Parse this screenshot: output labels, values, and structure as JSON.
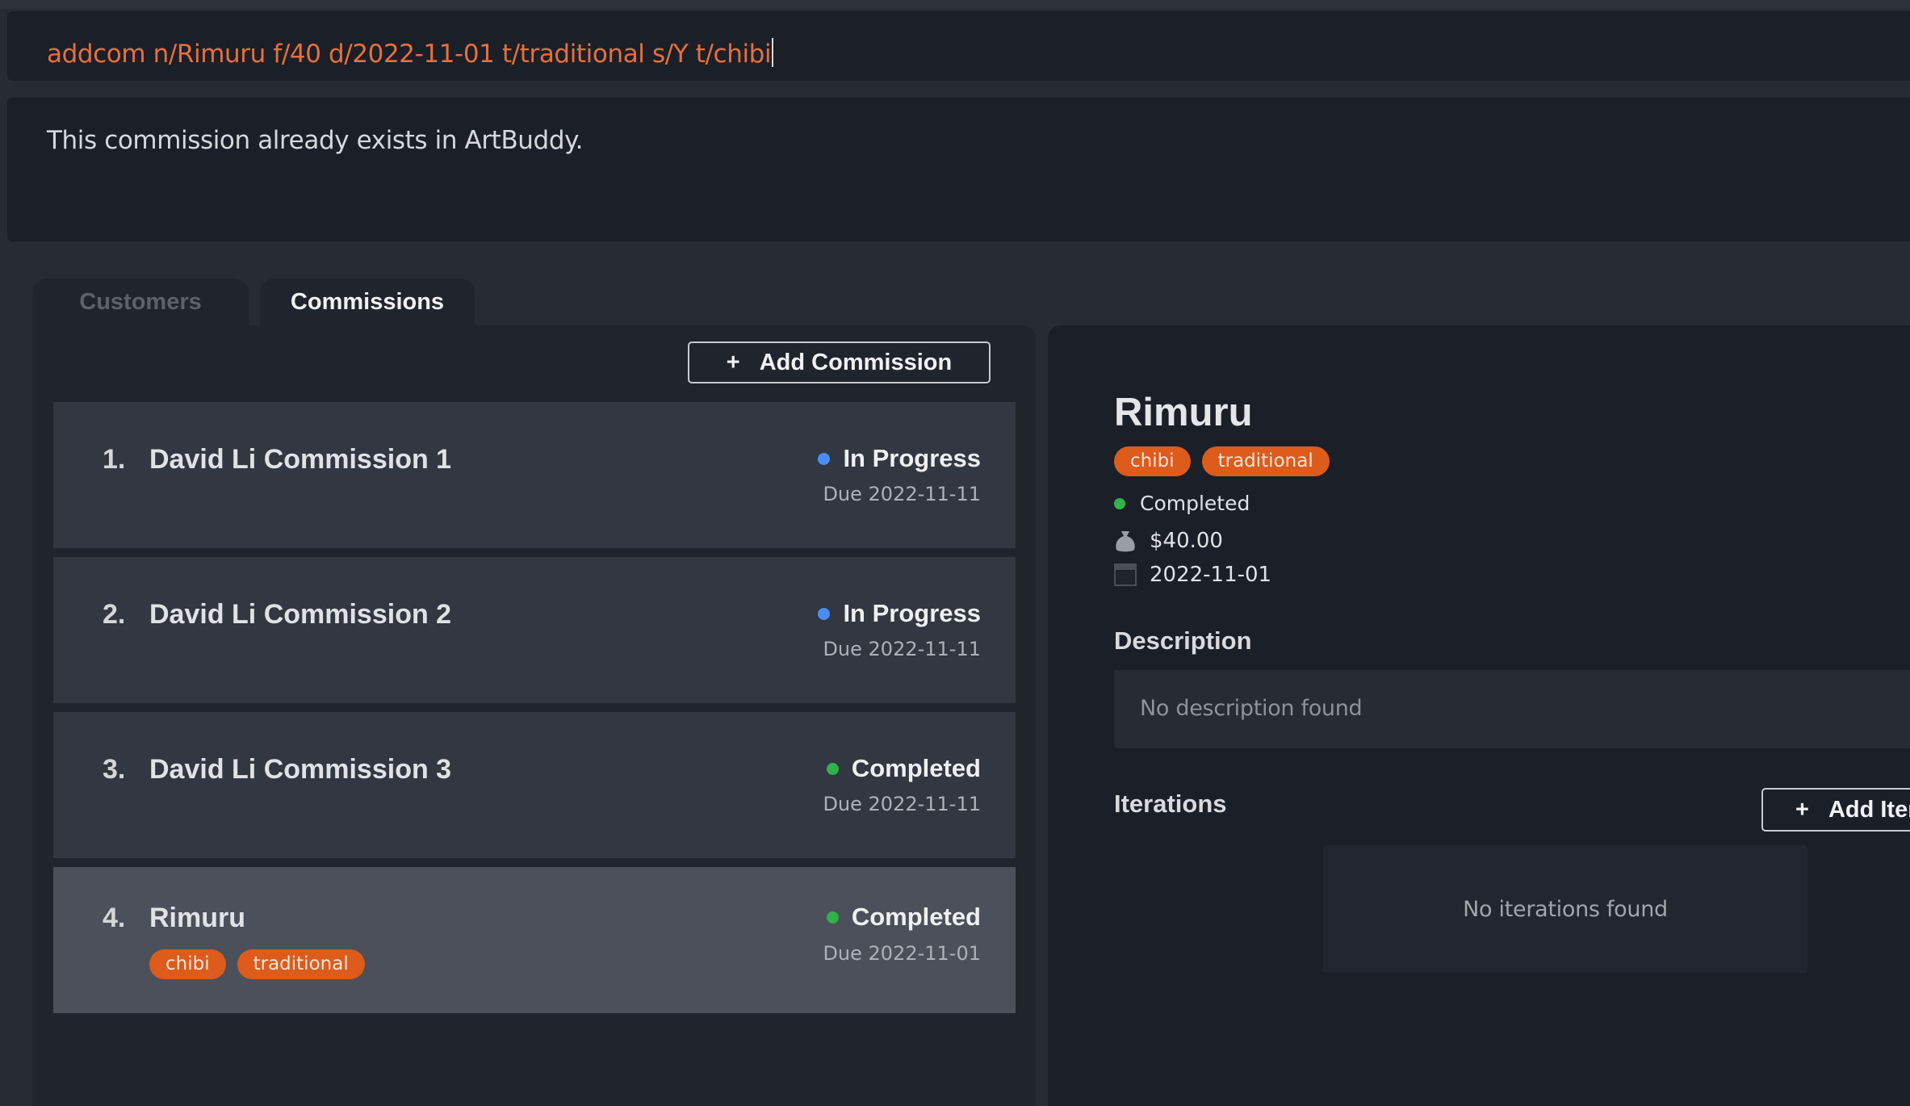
{
  "command": {
    "value": "addcom n/Rimuru f/40 d/2022-11-01 t/traditional s/Y t/chibi"
  },
  "result": {
    "message": "This commission already exists in ArtBuddy."
  },
  "tabs": [
    {
      "label": "Customers",
      "active": false
    },
    {
      "label": "Commissions",
      "active": true
    }
  ],
  "commission_list": {
    "add_button_label": "Add Commission",
    "add_button_icon": "+",
    "items": [
      {
        "index": "1.",
        "title": "David Li Commission 1",
        "status": "In Progress",
        "status_color": "#4a8ef5",
        "due": "Due 2022-11-11",
        "tags": []
      },
      {
        "index": "2.",
        "title": "David Li Commission 2",
        "status": "In Progress",
        "status_color": "#4a8ef5",
        "due": "Due 2022-11-11",
        "tags": []
      },
      {
        "index": "3.",
        "title": "David Li Commission 3",
        "status": "Completed",
        "status_color": "#2fb34a",
        "due": "Due 2022-11-11",
        "tags": []
      },
      {
        "index": "4.",
        "title": "Rimuru",
        "status": "Completed",
        "status_color": "#2fb34a",
        "due": "Due 2022-11-01",
        "tags": [
          "chibi",
          "traditional"
        ],
        "selected": true
      }
    ]
  },
  "detail": {
    "title": "Rimuru",
    "tags": [
      "chibi",
      "traditional"
    ],
    "status": "Completed",
    "status_color": "#2fb34a",
    "fee": "$40.00",
    "fee_icon": "money-bag-icon",
    "date": "2022-11-01",
    "date_icon": "calendar-icon",
    "description_heading": "Description",
    "description": "No description found",
    "iterations_heading": "Iterations",
    "add_iteration_label": "Add Iteration",
    "add_iteration_icon": "+",
    "iterations_empty": "No iterations found"
  },
  "colors": {
    "tag_bg": "#dd5b1b",
    "command_text": "#e6703c"
  }
}
